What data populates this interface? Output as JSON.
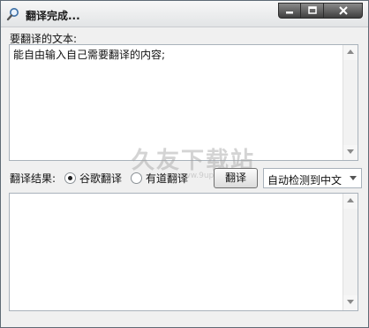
{
  "window": {
    "title": "翻译完成...",
    "buttons": [
      "minimize-icon",
      "maximize-icon",
      "close-icon"
    ]
  },
  "source": {
    "label": "要翻译的文本:",
    "value": "能自由输入自己需要翻译的内容;"
  },
  "controls": {
    "result_label": "翻译结果:",
    "engines": [
      {
        "label": "谷歌翻译",
        "selected": true
      },
      {
        "label": "有道翻译",
        "selected": false
      }
    ],
    "translate_label": "翻译",
    "language_selected": "自动检测到中文"
  },
  "result": {
    "value": ""
  },
  "watermark": {
    "text": "久友下载站",
    "sub": "www.9upk.com"
  }
}
